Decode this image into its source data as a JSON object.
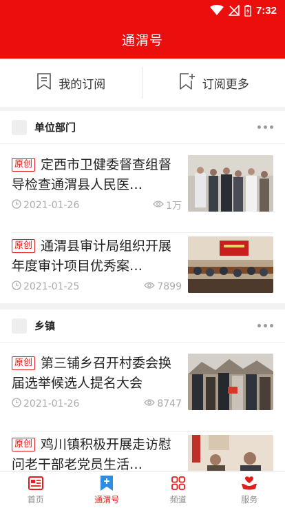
{
  "status": {
    "time": "7:32"
  },
  "header": {
    "title": "通渭号"
  },
  "subscription": {
    "my_subs": "我的订阅",
    "more_subs": "订阅更多"
  },
  "sections": [
    {
      "name": "单位部门",
      "items": [
        {
          "tag": "原创",
          "title": "定西市卫健委督查组督导检查通渭县人民医…",
          "date": "2021-01-26",
          "views": "1万"
        },
        {
          "tag": "原创",
          "title": "通渭县审计局组织开展年度审计项目优秀案…",
          "date": "2021-01-25",
          "views": "7899"
        }
      ]
    },
    {
      "name": "乡镇",
      "items": [
        {
          "tag": "原创",
          "title": "第三铺乡召开村委会换届选举候选人提名大会",
          "date": "2021-01-26",
          "views": "8747"
        },
        {
          "tag": "原创",
          "title": "鸡川镇积极开展走访慰问老干部老党员生活…",
          "date": "",
          "views": ""
        }
      ]
    }
  ],
  "nav": [
    {
      "label": "首页",
      "icon": "newspaper-icon"
    },
    {
      "label": "通渭号",
      "icon": "plus-bookmark-icon"
    },
    {
      "label": "频道",
      "icon": "grid-icon"
    },
    {
      "label": "服务",
      "icon": "service-hands-icon"
    }
  ],
  "colors": {
    "brand_red": "#ec0d0d",
    "tag_red": "#e31c1c",
    "meta_gray": "#aaaaaa"
  }
}
